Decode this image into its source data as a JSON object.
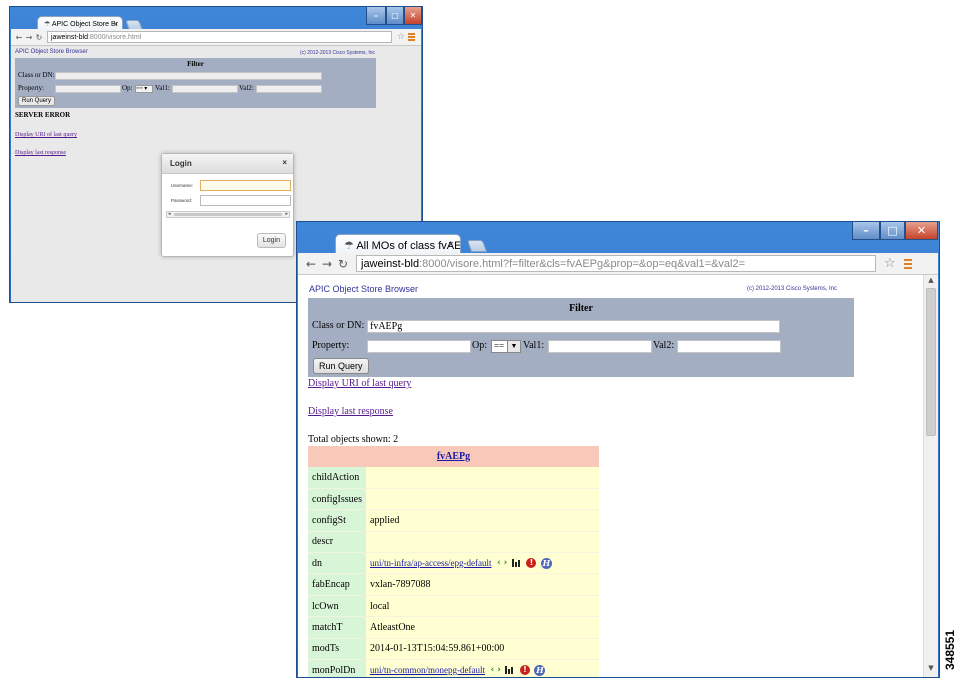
{
  "back_window": {
    "tab_title": "APIC Object Store Br",
    "url_host": "jaweinst-bld",
    "url_path": ":8000/visore.html",
    "page": {
      "brand": "APIC Object Store Browser",
      "copyright": "(c) 2012-2013 Cisco Systems, Inc",
      "filter_title": "Filter",
      "class_or_dn_label": "Class or DN:",
      "property_label": "Property:",
      "op_label": "Op:",
      "op_value": "==",
      "val1_label": "Val1:",
      "val2_label": "Val2:",
      "run_query": "Run Query",
      "error": "SERVER ERROR",
      "link_uri": "Display URI of last query",
      "link_response": "Display last response"
    },
    "login_dialog": {
      "title": "Login",
      "close": "×",
      "username_label": "Username:",
      "password_label": "Password:",
      "button": "Login"
    }
  },
  "front_window": {
    "tab_title": "All MOs of class fvAE",
    "url_host": "jaweinst-bld",
    "url_path": ":8000/visore.html?f=filter&cls=fvAEPg&prop=&op=eq&val1=&val2=",
    "page": {
      "brand": "APIC Object Store Browser",
      "copyright": "(c) 2012-2013 Cisco Systems, Inc",
      "filter_title": "Filter",
      "class_or_dn_label": "Class or DN:",
      "class_or_dn_value": "fvAEPg",
      "property_label": "Property:",
      "op_label": "Op:",
      "op_value": "==",
      "val1_label": "Val1:",
      "val2_label": "Val2:",
      "run_query": "Run Query",
      "link_uri": "Display URI of last query",
      "link_response": "Display last response",
      "total": "Total objects shown: 2",
      "table_header": "fvAEPg",
      "rows": [
        {
          "key": "childAction",
          "value": ""
        },
        {
          "key": "configIssues",
          "value": ""
        },
        {
          "key": "configSt",
          "value": "applied"
        },
        {
          "key": "descr",
          "value": ""
        },
        {
          "key": "dn",
          "value": "uni/tn-infra/ap-access/epg-default",
          "link": true
        },
        {
          "key": "fabEncap",
          "value": "vxlan-7897088"
        },
        {
          "key": "lcOwn",
          "value": "local"
        },
        {
          "key": "matchT",
          "value": "AtleastOne"
        },
        {
          "key": "modTs",
          "value": "2014-01-13T15:04:59.861+00:00"
        },
        {
          "key": "monPolDn",
          "value": "uni/tn-common/monepg-default",
          "link": true
        }
      ]
    }
  },
  "icons": {
    "nav_prev": "‹",
    "nav_next": "›",
    "fault": "!",
    "history": "H"
  },
  "figure_id": "348551"
}
